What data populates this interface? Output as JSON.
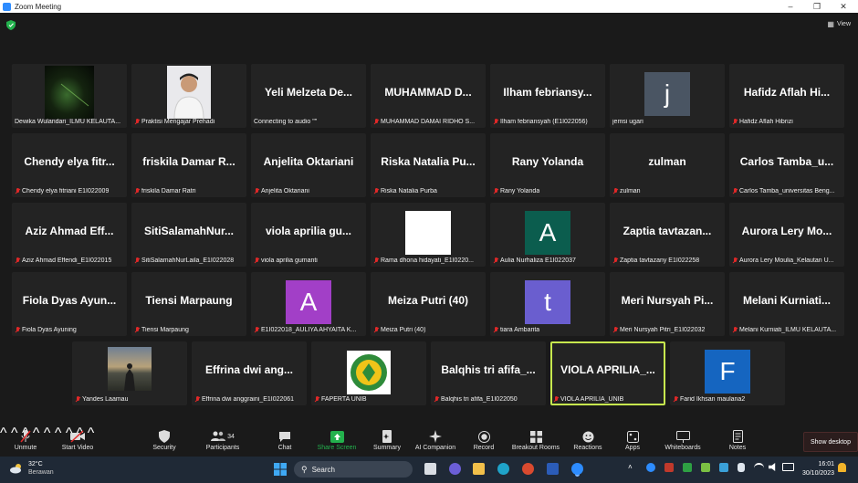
{
  "window": {
    "title": "Zoom Meeting"
  },
  "top": {
    "view_label": "View"
  },
  "tiles": [
    {
      "big": "",
      "label": "Dewika Wulandari_ILMU KELAUTA...",
      "muted": false,
      "kind": "photo-dark"
    },
    {
      "big": "",
      "label": "Praktisi Mengajar Prehadi",
      "muted": true,
      "kind": "photo-person"
    },
    {
      "big": "Yeli Melzeta De...",
      "label": "Connecting to audio \"\"",
      "muted": false,
      "kind": "name"
    },
    {
      "big": "MUHAMMAD D...",
      "label": "MUHAMMAD DAMAI RIDHO S...",
      "muted": true,
      "kind": "name"
    },
    {
      "big": "Ilham febriansy...",
      "label": "Ilham febriansyah (E1I022056)",
      "muted": true,
      "kind": "name"
    },
    {
      "big": "j",
      "label": "jemsi ugari",
      "muted": false,
      "kind": "avatar",
      "color": "#4a5563"
    },
    {
      "big": "Hafidz Aflah Hi...",
      "label": "Hafidz Aflah Hibrizi",
      "muted": true,
      "kind": "name"
    },
    {
      "big": "Chendy elya fitr...",
      "label": "Chendy elya fitriani E1I022009",
      "muted": true,
      "kind": "name"
    },
    {
      "big": "friskila Damar R...",
      "label": "friskila Damar Ratri",
      "muted": true,
      "kind": "name"
    },
    {
      "big": "Anjelita Oktariani",
      "label": "Anjelita Oktariani",
      "muted": true,
      "kind": "name"
    },
    {
      "big": "Riska Natalia Pu...",
      "label": "Riska Natalia Purba",
      "muted": true,
      "kind": "name"
    },
    {
      "big": "Rany Yolanda",
      "label": "Rany Yolanda",
      "muted": true,
      "kind": "name"
    },
    {
      "big": "zulman",
      "label": "zulman",
      "muted": true,
      "kind": "name"
    },
    {
      "big": "Carlos Tamba_u...",
      "label": "Carlos Tamba_universitas Beng...",
      "muted": true,
      "kind": "name"
    },
    {
      "big": "Aziz Ahmad Eff...",
      "label": "Aziz Ahmad Effendi_E1I022015",
      "muted": true,
      "kind": "name"
    },
    {
      "big": "SitiSalamahNur...",
      "label": "SitiSalamahNurLaila_E1I022028",
      "muted": true,
      "kind": "name"
    },
    {
      "big": "viola aprilia gu...",
      "label": "viola aprilia gumanti",
      "muted": true,
      "kind": "name"
    },
    {
      "big": "",
      "label": "Rama dhona hidayati_E1I0220...",
      "muted": true,
      "kind": "white"
    },
    {
      "big": "A",
      "label": "Aulia Nurhaliza E1I022037",
      "muted": true,
      "kind": "avatar",
      "color": "#0b5d4e"
    },
    {
      "big": "Zaptia tavtazan...",
      "label": "Zaptia tavtazany E1I022258",
      "muted": true,
      "kind": "name"
    },
    {
      "big": "Aurora Lery Mo...",
      "label": "Aurora Lery Moulia_Kelautan U...",
      "muted": true,
      "kind": "name"
    },
    {
      "big": "Fiola Dyas Ayun...",
      "label": "Fiola Dyas Ayuning",
      "muted": true,
      "kind": "name"
    },
    {
      "big": "Tiensi Marpaung",
      "label": "Tiensi Marpaung",
      "muted": true,
      "kind": "name"
    },
    {
      "big": "A",
      "label": "E1I022018_AULIYA AHYAITA K...",
      "muted": true,
      "kind": "avatar",
      "color": "#a23fc7"
    },
    {
      "big": "Meiza Putri (40)",
      "label": "Meiza Putri (40)",
      "muted": true,
      "kind": "name"
    },
    {
      "big": "t",
      "label": "tiara Ambarita",
      "muted": true,
      "kind": "avatar",
      "color": "#6a5ecf"
    },
    {
      "big": "Meri Nursyah Pi...",
      "label": "Meri Nursyah Pitri_E1I022032",
      "muted": true,
      "kind": "name"
    },
    {
      "big": "Melani Kurniati...",
      "label": "Melani Kurniati_ILMU KELAUTA...",
      "muted": true,
      "kind": "name"
    },
    {
      "big": "",
      "label": "Yandes Laamau",
      "muted": true,
      "kind": "photo-sunset"
    },
    {
      "big": "Effrina dwi ang...",
      "label": "Effrina dwi anggraini_E1I022061",
      "muted": true,
      "kind": "name"
    },
    {
      "big": "",
      "label": "FAPERTA UNIB",
      "muted": true,
      "kind": "logo"
    },
    {
      "big": "Balqhis tri afifa_...",
      "label": "Balqhis tri afifa_E1I022050",
      "muted": true,
      "kind": "name"
    },
    {
      "big": "VIOLA APRILIA_...",
      "label": "VIOLA APRILIA_UNIB",
      "muted": true,
      "kind": "name",
      "speaking": true
    },
    {
      "big": "F",
      "label": "Farid Ikhsan maulana2",
      "muted": true,
      "kind": "avatar",
      "color": "#1565c0"
    }
  ],
  "toolbar": {
    "unmute": "Unmute",
    "start_video": "Start Video",
    "security": "Security",
    "participants": "Participants",
    "participants_count": "34",
    "chat": "Chat",
    "share_screen": "Share Screen",
    "summary": "Summary",
    "ai_companion": "AI Companion",
    "record": "Record",
    "breakout_rooms": "Breakout Rooms",
    "reactions": "Reactions",
    "apps": "Apps",
    "whiteboards": "Whiteboards",
    "notes": "Notes",
    "show_desktop": "Show desktop"
  },
  "taskbar": {
    "temperature": "32°C",
    "weather": "Berawan",
    "search_placeholder": "Search",
    "time": "16:01",
    "date": "30/10/2023"
  }
}
